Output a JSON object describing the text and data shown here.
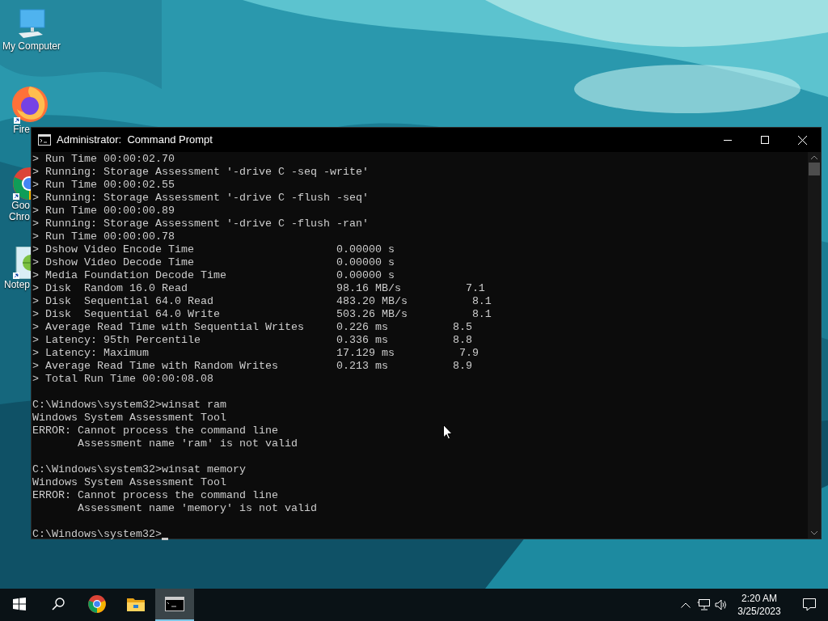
{
  "desktop_icons": [
    {
      "kind": "computer",
      "label_lines": [
        "My Computer"
      ]
    },
    {
      "kind": "firefox",
      "label_lines": [
        "Fire"
      ]
    },
    {
      "kind": "chrome",
      "label_lines": [
        "Goo",
        "Chro"
      ]
    },
    {
      "kind": "notepad",
      "label_lines": [
        "Notep"
      ]
    }
  ],
  "window": {
    "title": "Administrator:  Command Prompt",
    "blocks": [
      [
        "> Run Time 00:00:02.70",
        "> Running: Storage Assessment '-drive C -seq -write'",
        "> Run Time 00:00:02.55",
        "> Running: Storage Assessment '-drive C -flush -seq'",
        "> Run Time 00:00:00.89",
        "> Running: Storage Assessment '-drive C -flush -ran'",
        "> Run Time 00:00:00.78",
        "> Dshow Video Encode Time                      0.00000 s",
        "> Dshow Video Decode Time                      0.00000 s",
        "> Media Foundation Decode Time                 0.00000 s",
        "> Disk  Random 16.0 Read                       98.16 MB/s          7.1",
        "> Disk  Sequential 64.0 Read                   483.20 MB/s          8.1",
        "> Disk  Sequential 64.0 Write                  503.26 MB/s          8.1",
        "> Average Read Time with Sequential Writes     0.226 ms          8.5",
        "> Latency: 95th Percentile                     0.336 ms          8.8",
        "> Latency: Maximum                             17.129 ms          7.9",
        "> Average Read Time with Random Writes         0.213 ms          8.9",
        "> Total Run Time 00:00:08.08"
      ],
      [
        "C:\\Windows\\system32>winsat ram",
        "Windows System Assessment Tool",
        "ERROR: Cannot process the command line",
        "       Assessment name 'ram' is not valid"
      ],
      [
        "C:\\Windows\\system32>winsat memory",
        "Windows System Assessment Tool",
        "ERROR: Cannot process the command line",
        "       Assessment name 'memory' is not valid"
      ],
      [
        "C:\\Windows\\system32>"
      ]
    ],
    "text_cursor": true
  },
  "taskbar": {
    "items": [
      {
        "kind": "start",
        "selected": false
      },
      {
        "kind": "search",
        "selected": false
      },
      {
        "kind": "chrome",
        "selected": false
      },
      {
        "kind": "explorer",
        "selected": false
      },
      {
        "kind": "cmd",
        "selected": true
      }
    ],
    "clock": {
      "time": "2:20 AM",
      "date": "3/25/2023"
    }
  }
}
